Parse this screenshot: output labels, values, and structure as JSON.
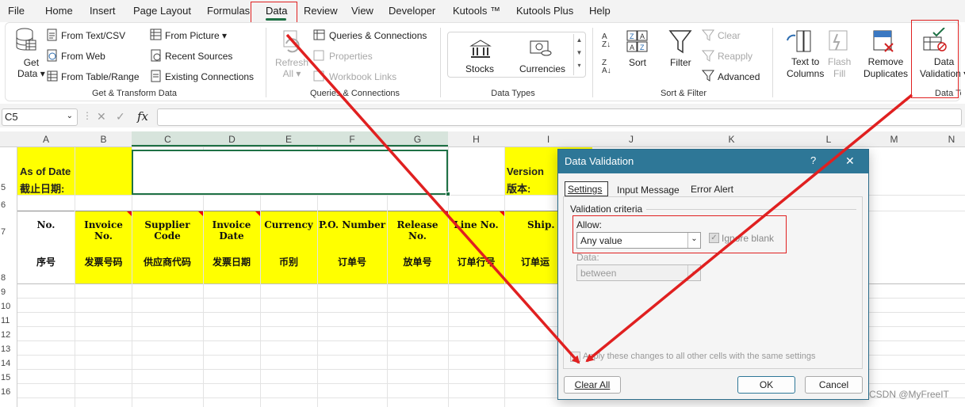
{
  "menu": [
    "File",
    "Home",
    "Insert",
    "Page Layout",
    "Formulas",
    "Data",
    "Review",
    "View",
    "Developer",
    "Kutools ™",
    "Kutools Plus",
    "Help"
  ],
  "ribbon": {
    "get_data": [
      "Get",
      "Data"
    ],
    "from_text_csv": "From Text/CSV",
    "from_web": "From Web",
    "from_table_range": "From Table/Range",
    "from_picture": "From Picture",
    "recent_sources": "Recent Sources",
    "existing_connections": "Existing Connections",
    "group_get_transform": "Get & Transform Data",
    "refresh_all": [
      "Refresh",
      "All"
    ],
    "queries_connections": "Queries & Connections",
    "properties": "Properties",
    "workbook_links": "Workbook Links",
    "group_queries": "Queries & Connections",
    "stocks": "Stocks",
    "currencies": "Currencies",
    "group_data_types": "Data Types",
    "sort": "Sort",
    "filter": "Filter",
    "clear": "Clear",
    "reapply": "Reapply",
    "advanced": "Advanced",
    "group_sort_filter": "Sort & Filter",
    "text_to_columns": [
      "Text to",
      "Columns"
    ],
    "flash_fill": [
      "Flash",
      "Fill"
    ],
    "remove_duplicates": [
      "Remove",
      "Duplicates"
    ],
    "data_validation": [
      "Data",
      "Validation"
    ],
    "group_data_tools": "Data To"
  },
  "formula_bar": {
    "name_box": "C5",
    "fx": "fx"
  },
  "columns": [
    "A",
    "B",
    "C",
    "D",
    "E",
    "F",
    "G",
    "H",
    "I",
    "J",
    "K",
    "L",
    "M",
    "N"
  ],
  "rows": [
    "5",
    "6",
    "7",
    "8",
    "9",
    "10",
    "11",
    "12",
    "13",
    "14",
    "15",
    "16"
  ],
  "sheet": {
    "as_of_date_en": "As of Date",
    "as_of_date_cn": "截止日期:",
    "version_en": "Version",
    "version_cn": "版本:",
    "headers_en": [
      "No.",
      "Invoice No.",
      "Supplier Code",
      "Invoice Date",
      "Currency",
      "P.O. Number",
      "Release No.",
      "Line No.",
      "Ship. N"
    ],
    "headers_cn": [
      "序号",
      "发票号码",
      "供应商代码",
      "发票日期",
      "币别",
      "订单号",
      "放单号",
      "订单行号",
      "订单运"
    ]
  },
  "dialog": {
    "title": "Data Validation",
    "help": "?",
    "close": "✕",
    "tabs": [
      "Settings",
      "Input Message",
      "Error Alert"
    ],
    "criteria_label": "Validation criteria",
    "allow_label": "Allow:",
    "allow_value": "Any value",
    "ignore_blank": "Ignore blank",
    "data_label": "Data:",
    "data_value": "between",
    "apply_all": "Apply these changes to all other cells with the same settings",
    "clear_all": "Clear All",
    "ok": "OK",
    "cancel": "Cancel"
  },
  "watermark": "CSDN @MyFreeIT",
  "colors": {
    "accent_red": "#e02020",
    "title_blue": "#2e7797",
    "cell_yellow": "#ffff00",
    "excel_green": "#1e7145"
  }
}
